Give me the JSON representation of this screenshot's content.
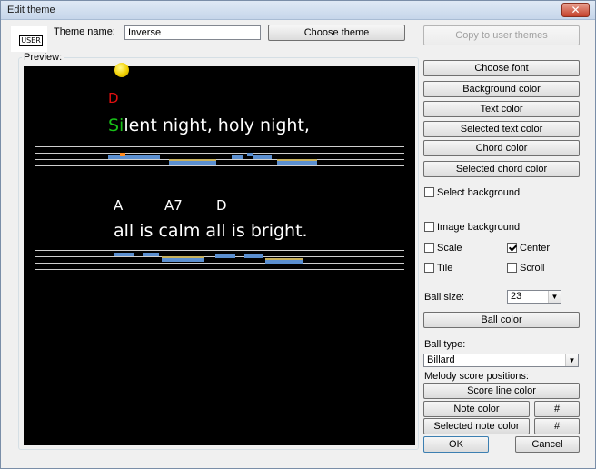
{
  "window": {
    "title": "Edit theme",
    "close_glyph": "✕"
  },
  "theme": {
    "badge": "USER",
    "name_label": "Theme name:",
    "name_value": "Inverse",
    "choose_theme": "Choose theme",
    "copy_to_user": "Copy to user themes"
  },
  "preview": {
    "label": "Preview:",
    "line1_chord": "D",
    "line1_hl": "Si",
    "line1_rest": "lent night, holy night,",
    "line2_chords": [
      "A",
      "A7",
      "D"
    ],
    "line2_lyric": "all is calm all is bright."
  },
  "buttons": {
    "choose_font": "Choose font",
    "background_color": "Background color",
    "text_color": "Text color",
    "selected_text_color": "Selected text color",
    "chord_color": "Chord color",
    "selected_chord_color": "Selected chord color",
    "ball_color": "Ball color",
    "score_line_color": "Score line color",
    "note_color": "Note color",
    "selected_note_color": "Selected note color",
    "hash": "#",
    "ok": "OK",
    "cancel": "Cancel"
  },
  "options": {
    "select_background": "Select background",
    "image_background": "Image background",
    "scale": "Scale",
    "center": "Center",
    "tile": "Tile",
    "scroll": "Scroll",
    "center_checked": true
  },
  "ball": {
    "size_label": "Ball size:",
    "size_value": "23",
    "type_label": "Ball type:",
    "type_value": "Billard"
  },
  "melody": {
    "label": "Melody score positions:"
  },
  "colors": {
    "background": "#000000",
    "text": "#ffffff",
    "selected_text": "#18c018",
    "chord": "#ffffff",
    "selected_chord": "#e01010",
    "ball": "#f2d000",
    "note": "#5b8fd0",
    "selected_note": "#ff8a1e"
  }
}
